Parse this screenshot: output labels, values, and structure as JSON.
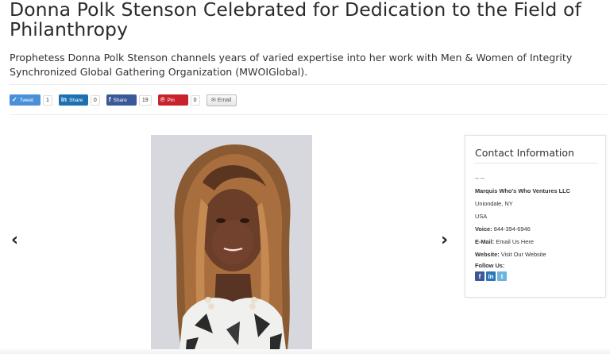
{
  "article": {
    "title": "Donna Polk Stenson Celebrated for Dedication to the Field of Philanthropy",
    "summary": "Prophetess Donna Polk Stenson channels years of varied expertise into her work with Men & Women of Integrity Synchronized Global Gathering Organization (MWOIGlobal)."
  },
  "share": {
    "tweet_label": "Tweet",
    "tweet_count": "1",
    "linkedin_label": "Share",
    "linkedin_count": "0",
    "facebook_label": "Share",
    "facebook_count": "19",
    "pin_label": "Pin",
    "pin_count": "0",
    "email_label": "Email"
  },
  "contact": {
    "title": "Contact Information",
    "dash": "-- --",
    "company": "Marquis Who's Who Ventures LLC",
    "city": "Uniondale, NY",
    "country": "USA",
    "voice_label": "Voice:",
    "voice_value": "844-394-6946",
    "email_label": "E-Mail:",
    "email_value": "Email Us Here",
    "website_label": "Website:",
    "website_value": "Visit Our Website",
    "follow_label": "Follow Us:"
  },
  "colors": {
    "twitter": "#4a90d9",
    "linkedin": "#1e6fb0",
    "facebook": "#3b5998",
    "pinterest": "#c8232c"
  },
  "icons": [
    "chevron-left-icon",
    "chevron-right-icon",
    "twitter-icon",
    "linkedin-icon",
    "facebook-icon",
    "pinterest-icon",
    "envelope-icon"
  ]
}
